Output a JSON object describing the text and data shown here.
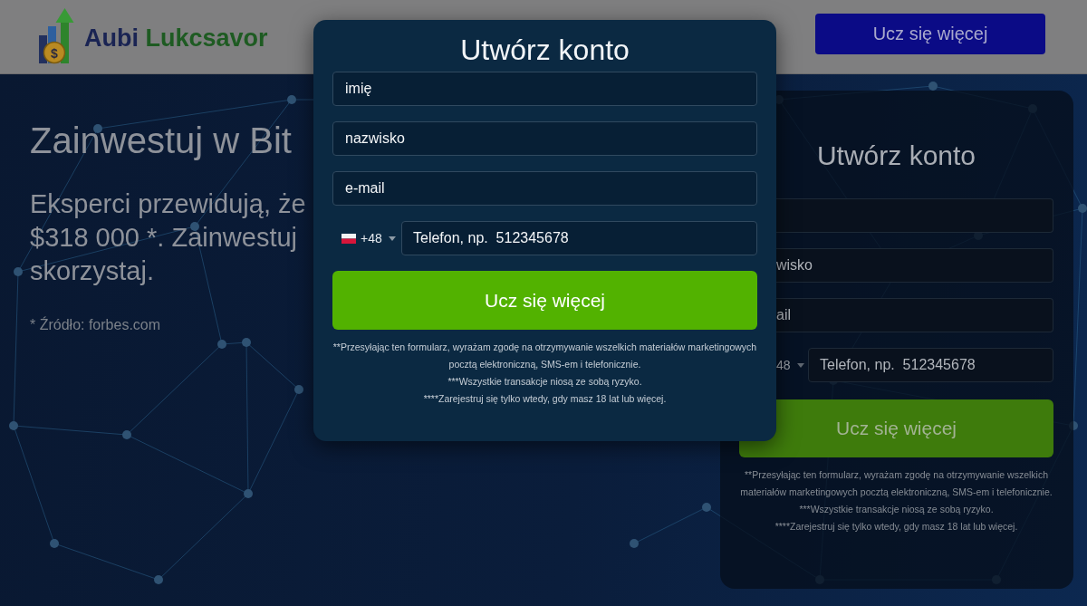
{
  "header": {
    "logo": {
      "symbol": "$",
      "brand": [
        "Aubi",
        "Lukcsavor"
      ]
    },
    "button": "Ucz się więcej"
  },
  "hero": {
    "headline": "Zainwestuj w Bit",
    "subheadline_lines": [
      "Eksperci przewidują, że",
      "$318 000 *. Zainwestuj",
      "skorzystaj."
    ],
    "source": "* Źródło: forbes.com"
  },
  "background_form": {
    "title": "Utwórz konto",
    "fields": [
      {
        "kind": "text"
      },
      {
        "kind": "text",
        "placeholder": "wisko"
      },
      {
        "kind": "text",
        "placeholder": "ail"
      },
      {
        "kind": "phone",
        "code": "48",
        "placeholder": "Telefon, np.  512345678"
      }
    ],
    "button": "Ucz się więcej",
    "disclaimers": [
      "**Przesyłając ten formularz, wyrażam zgodę na otrzymywanie wszelkich materiałów marketingowych pocztą elektroniczną, SMS-em i telefonicznie.",
      "***Wszystkie transakcje niosą ze sobą ryzyko.",
      "****Zarejestruj się tylko wtedy, gdy masz 18 lat lub więcej."
    ]
  },
  "modal": {
    "title": "Utwórz konto",
    "fields": [
      {
        "kind": "text",
        "placeholder": "imię"
      },
      {
        "kind": "text",
        "placeholder": "nazwisko"
      },
      {
        "kind": "text",
        "placeholder": "e-mail"
      },
      {
        "kind": "phone",
        "code": "+48",
        "placeholder": "Telefon, np.  512345678"
      }
    ],
    "button": "Ucz się więcej",
    "disclaimers": [
      "**Przesyłając ten formularz, wyrażam zgodę na otrzymywanie wszelkich materiałów marketingowych pocztą elektroniczną, SMS-em i telefonicznie.",
      "***Wszystkie transakcje niosą ze sobą ryzyko.",
      "****Zarejestruj się tylko wtedy, gdy masz 18 lat lub więcej."
    ]
  }
}
